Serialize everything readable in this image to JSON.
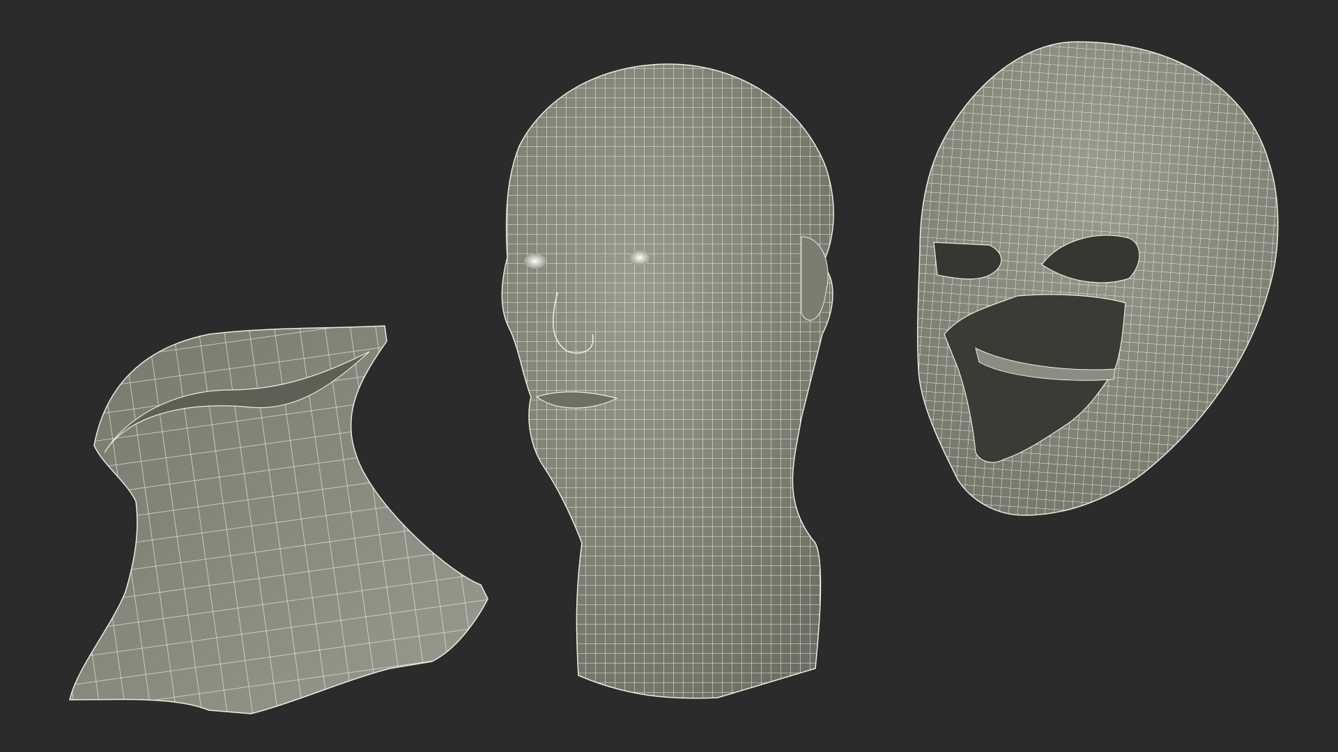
{
  "scene": {
    "background_color": "#2b2b2b",
    "mesh_fill_color": "#8a8a7e",
    "mesh_shadow_color": "#5f5f56",
    "wire_color": "#eeeee0",
    "interior_color": "#3a3b35",
    "objects": [
      {
        "name": "neck-collar-mesh"
      },
      {
        "name": "human-head-mesh"
      },
      {
        "name": "face-mask-mesh"
      }
    ]
  }
}
